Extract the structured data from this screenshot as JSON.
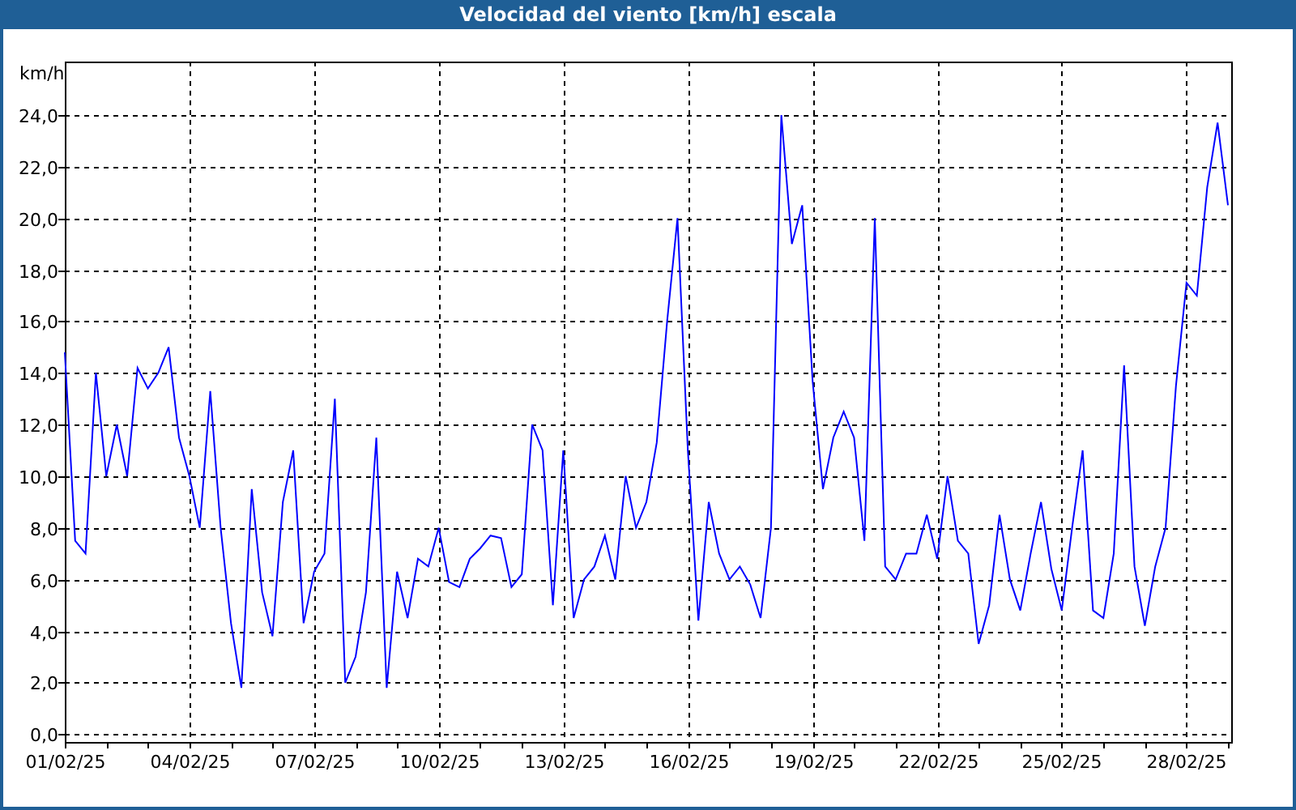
{
  "window": {
    "title": "Velocidad del viento [km/h] escala"
  },
  "chart": {
    "chart_data": {
      "type": "line",
      "grid": true,
      "ylabel": "km/h",
      "ylim": [
        -0.3,
        26.07
      ],
      "categories": [
        "01/02/25",
        null,
        null,
        null,
        null,
        null,
        null,
        null,
        null,
        null,
        null,
        null,
        "04/02/25",
        null,
        null,
        null,
        null,
        null,
        null,
        null,
        null,
        null,
        null,
        null,
        "07/02/25",
        null,
        null,
        null,
        null,
        null,
        null,
        null,
        null,
        null,
        null,
        null,
        "10/02/25",
        null,
        null,
        null,
        null,
        null,
        null,
        null,
        null,
        null,
        null,
        null,
        "13/02/25",
        null,
        null,
        null,
        null,
        null,
        null,
        null,
        null,
        null,
        null,
        null,
        "16/02/25",
        null,
        null,
        null,
        null,
        null,
        null,
        null,
        null,
        null,
        null,
        null,
        "19/02/25",
        null,
        null,
        null,
        null,
        null,
        null,
        null,
        null,
        null,
        null,
        null,
        "22/02/25",
        null,
        null,
        null,
        null,
        null,
        null,
        null,
        null,
        null,
        null,
        null,
        "25/02/25",
        null,
        null,
        null,
        null,
        null,
        null,
        null,
        null,
        null,
        null,
        null,
        "28/02/25",
        null,
        null,
        null,
        null
      ],
      "yticks": [
        {
          "value": 0,
          "label": "0,0"
        },
        {
          "value": 2,
          "label": "2,0"
        },
        {
          "value": 4,
          "label": "4,0"
        },
        {
          "value": 6,
          "label": "6,0"
        },
        {
          "value": 8,
          "label": "8,0"
        },
        {
          "value": 10,
          "label": "10,0"
        },
        {
          "value": 12,
          "label": "12,0"
        },
        {
          "value": 14,
          "label": "14,0"
        },
        {
          "value": 16,
          "label": "16,0"
        },
        {
          "value": 18,
          "label": "18,0"
        },
        {
          "value": 20,
          "label": "20,0"
        },
        {
          "value": 22,
          "label": "22,0"
        },
        {
          "value": 24,
          "label": "24,0"
        }
      ],
      "series": [
        {
          "color": "#0000ff",
          "values": [
            14.8,
            7.5,
            7,
            14,
            10,
            12,
            10,
            14.2,
            13.4,
            14,
            15,
            11.5,
            10,
            8,
            13.3,
            8,
            4.3,
            1.8,
            9.5,
            5.5,
            3.8,
            9,
            11,
            4.3,
            6.3,
            7,
            13,
            2,
            3,
            5.5,
            11.5,
            1.8,
            6.3,
            4.5,
            6.8,
            6.5,
            8,
            5.9,
            5.7,
            6.8,
            7.2,
            7.7,
            7.6,
            5.7,
            6.2,
            12,
            11,
            5,
            11,
            4.5,
            6,
            6.5,
            7.7,
            6,
            10,
            8,
            9,
            11.3,
            16,
            20,
            11,
            4.4,
            9,
            7,
            6,
            6.5,
            5.8,
            4.5,
            8,
            24,
            19,
            20.5,
            13.7,
            9.5,
            11.5,
            12.5,
            11.5,
            7.5,
            20,
            6.5,
            6,
            7,
            7,
            8.5,
            6.8,
            10,
            7.5,
            7,
            3.5,
            5,
            8.5,
            6,
            4.8,
            7,
            9,
            6.4,
            4.8,
            8,
            11,
            4.8,
            4.5,
            7,
            14.3,
            6.5,
            4.2,
            6.5,
            8,
            13.5,
            17.5,
            17,
            21.2,
            23.7,
            20.5
          ]
        }
      ]
    }
  }
}
